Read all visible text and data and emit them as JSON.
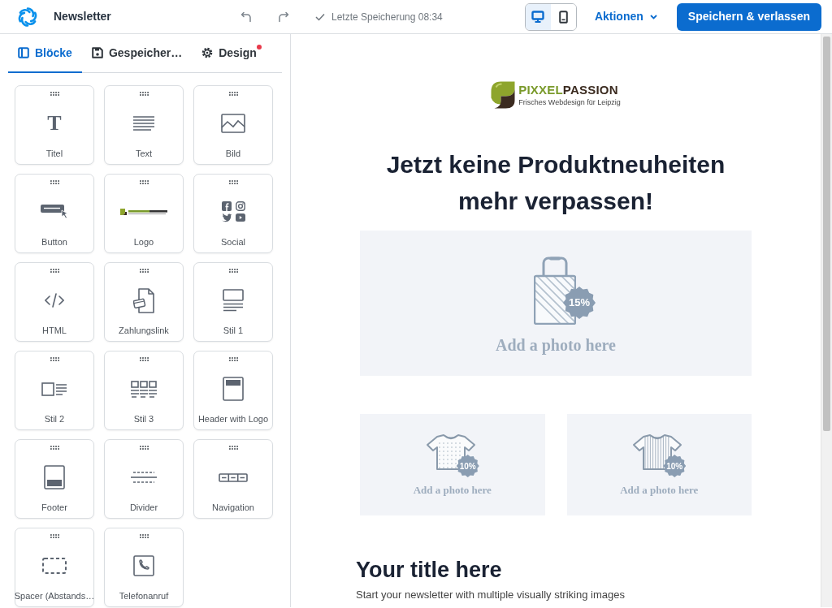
{
  "app": {
    "title": "Newsletter"
  },
  "toolbar": {
    "save_status": "Letzte Speicherung 08:34",
    "devices": [
      {
        "kind": "desktop",
        "selected": true
      },
      {
        "kind": "mobile",
        "selected": false
      }
    ],
    "actions_menu": "Aktionen",
    "save_button": "Speichern & verlassen"
  },
  "sidebar": {
    "tabs": [
      {
        "label": "Blöcke",
        "selected": true,
        "notification": false
      },
      {
        "label": "Gespeicher…",
        "selected": false,
        "notification": false
      },
      {
        "label": "Design",
        "selected": false,
        "notification": true
      }
    ],
    "blocks": [
      {
        "label": "Titel",
        "kind": "title",
        "glyph": "T"
      },
      {
        "label": "Text",
        "kind": "text"
      },
      {
        "label": "Bild",
        "kind": "image"
      },
      {
        "label": "Button",
        "kind": "button"
      },
      {
        "label": "Logo",
        "kind": "logo"
      },
      {
        "label": "Social",
        "kind": "social"
      },
      {
        "label": "HTML",
        "kind": "html"
      },
      {
        "label": "Zahlungslink",
        "kind": "payment"
      },
      {
        "label": "Stil 1",
        "kind": "style1"
      },
      {
        "label": "Stil 2",
        "kind": "style2"
      },
      {
        "label": "Stil 3",
        "kind": "style3"
      },
      {
        "label": "Header with Logo",
        "kind": "header"
      },
      {
        "label": "Footer",
        "kind": "footer"
      },
      {
        "label": "Divider",
        "kind": "divider"
      },
      {
        "label": "Navigation",
        "kind": "navigation"
      },
      {
        "label": "Spacer (Abstands…",
        "kind": "spacer"
      },
      {
        "label": "Telefonanruf",
        "kind": "phone"
      }
    ]
  },
  "preview": {
    "logo": {
      "wordmark": [
        {
          "text": "PIXXEL",
          "color": "#7a9a2b"
        },
        {
          "text": "PASSION",
          "color": "#3b2b20"
        }
      ],
      "tagline": "Frisches Webdesign für Leipzig"
    },
    "headline": "Jetzt keine Produktneuheiten mehr verpassen!",
    "hero": {
      "badge": "15%",
      "caption": "Add a photo here"
    },
    "products": [
      {
        "kind": "dotted",
        "badge": "10%",
        "caption": "Add a photo here"
      },
      {
        "kind": "striped",
        "badge": "10%",
        "caption": "Add a photo here"
      }
    ],
    "section_title": "Your title here",
    "body": "Start your newsletter with multiple visually striking images"
  }
}
